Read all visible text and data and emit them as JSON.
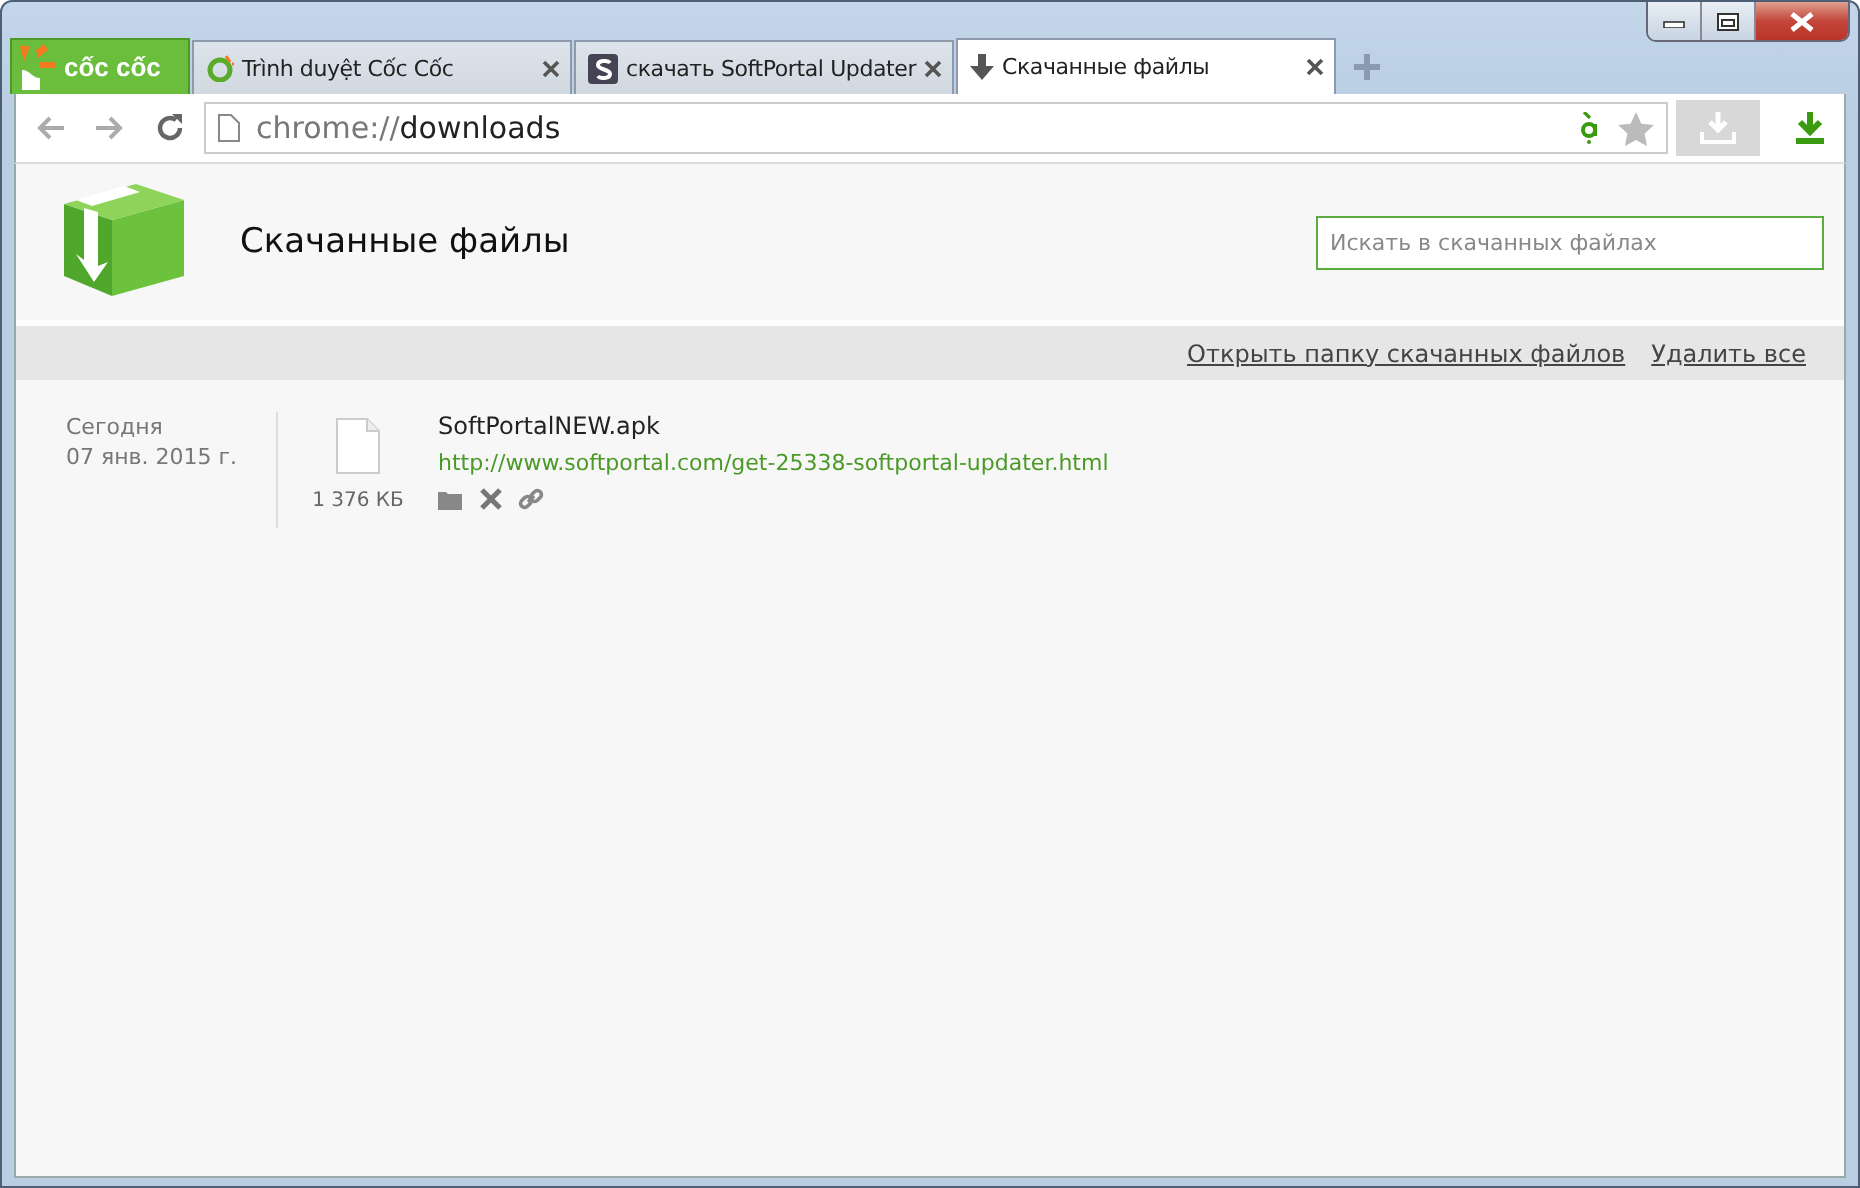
{
  "brand": {
    "label": "cốc cốc"
  },
  "tabs": [
    {
      "title": "Trình duyệt Cốc Cốc",
      "kind": "coccoc",
      "selected": false
    },
    {
      "title": "скачать SoftPortal Updater",
      "kind": "softportal",
      "selected": false
    },
    {
      "title": "Скачанные файлы",
      "kind": "download",
      "selected": true
    }
  ],
  "address": {
    "scheme": "chrome://",
    "path": "downloads"
  },
  "page": {
    "title": "Скачанные файлы",
    "search": {
      "placeholder": "Искать в скачанных файлах"
    },
    "links": [
      "Открыть папку скачанных файлов",
      "Удалить все"
    ],
    "downloads": [
      {
        "day": "Сегодня",
        "date": "07 янв. 2015 г.",
        "size": "1 376 КБ",
        "file": "SoftPortalNEW.apk",
        "url": "http://www.softportal.com/get-25338-softportal-updater.html"
      }
    ]
  }
}
